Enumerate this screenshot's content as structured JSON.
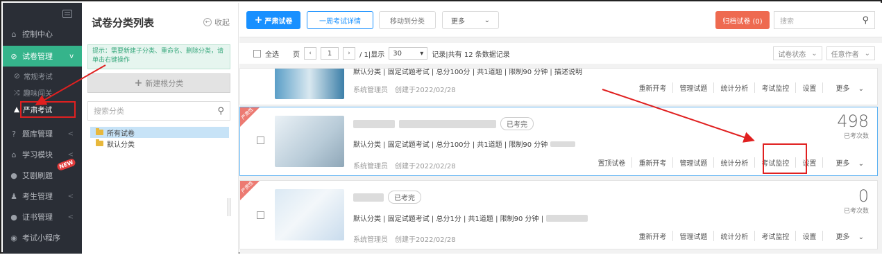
{
  "sidebar": {
    "items": [
      {
        "label": "控制中心",
        "icon": "home-icon"
      },
      {
        "label": "试卷管理",
        "icon": "check-circle-icon",
        "active": true
      },
      {
        "label": "题库管理",
        "icon": "question-icon"
      },
      {
        "label": "学习模块",
        "icon": "graduation-icon"
      },
      {
        "label": "艾剧刷题",
        "icon": "circle-icon",
        "badge": "NEW"
      },
      {
        "label": "考生管理",
        "icon": "user-icon"
      },
      {
        "label": "证书管理",
        "icon": "dot-icon"
      },
      {
        "label": "考试小程序",
        "icon": "wechat-icon"
      }
    ],
    "sub": [
      {
        "label": "常规考试",
        "icon": "check-icon"
      },
      {
        "label": "趣味闯关",
        "icon": "shuffle-icon"
      },
      {
        "label": "严肃考试",
        "icon": "warning-icon"
      }
    ],
    "chev": "<",
    "active_chev": "v"
  },
  "catpanel": {
    "title": "试卷分类列表",
    "fold": "收起",
    "tip": "提示：需要新建子分类、重命名、删除分类，请单击右键操作",
    "new_root": "新建根分类",
    "search_placeholder": "搜索分类",
    "tree": [
      "所有试卷",
      "默认分类"
    ]
  },
  "toolbar": {
    "serious_exam": "严肃试卷",
    "week_detail": "一周考试详情",
    "move_to": "移动到分类",
    "more": "更多",
    "archive": "归档试卷 (0)",
    "search_placeholder": "搜索"
  },
  "pager": {
    "select_all": "全选",
    "page_label": "页",
    "page": "1",
    "total_pages": "/ 1|显示",
    "page_size": "30",
    "records": "记录|共有 12 条数据记录",
    "status_filter": "试卷状态",
    "author_filter": "任意作者"
  },
  "cards": [
    {
      "creator": "系统管理员",
      "created": "创建于2022/02/28",
      "meta": "默认分类 | 固定试题考试 | 总分100分 | 共1道题 | 限制90 分钟 | 描述说明",
      "actions": [
        "重新开考",
        "管理试题",
        "统计分析",
        "考试监控",
        "设置",
        "更多"
      ]
    },
    {
      "ribbon": "严肃性",
      "status": "已考完",
      "meta": "默认分类 | 固定试题考试 | 总分100分 | 共1道题 | 限制90 分钟",
      "creator": "系统管理员",
      "created": "创建于2022/02/28",
      "count": "498",
      "count_label": "已考次数",
      "actions": [
        "置顶试卷",
        "重新开考",
        "管理试题",
        "统计分析",
        "考试监控",
        "设置",
        "更多"
      ]
    },
    {
      "ribbon": "严肃性",
      "status": "已考完",
      "meta": "默认分类 | 固定试题考试 | 总分1分 | 共1道题 | 限制90 分钟 |",
      "creator": "系统管理员",
      "created": "创建于2022/02/28",
      "count": "0",
      "count_label": "已考次数",
      "actions": [
        "重新开考",
        "管理试题",
        "统计分析",
        "考试监控",
        "设置",
        "更多"
      ]
    }
  ],
  "colors": {
    "accent": "#35b48b",
    "primary": "#1890ff",
    "archive": "#ee6a50",
    "highlight": "#e02020"
  }
}
